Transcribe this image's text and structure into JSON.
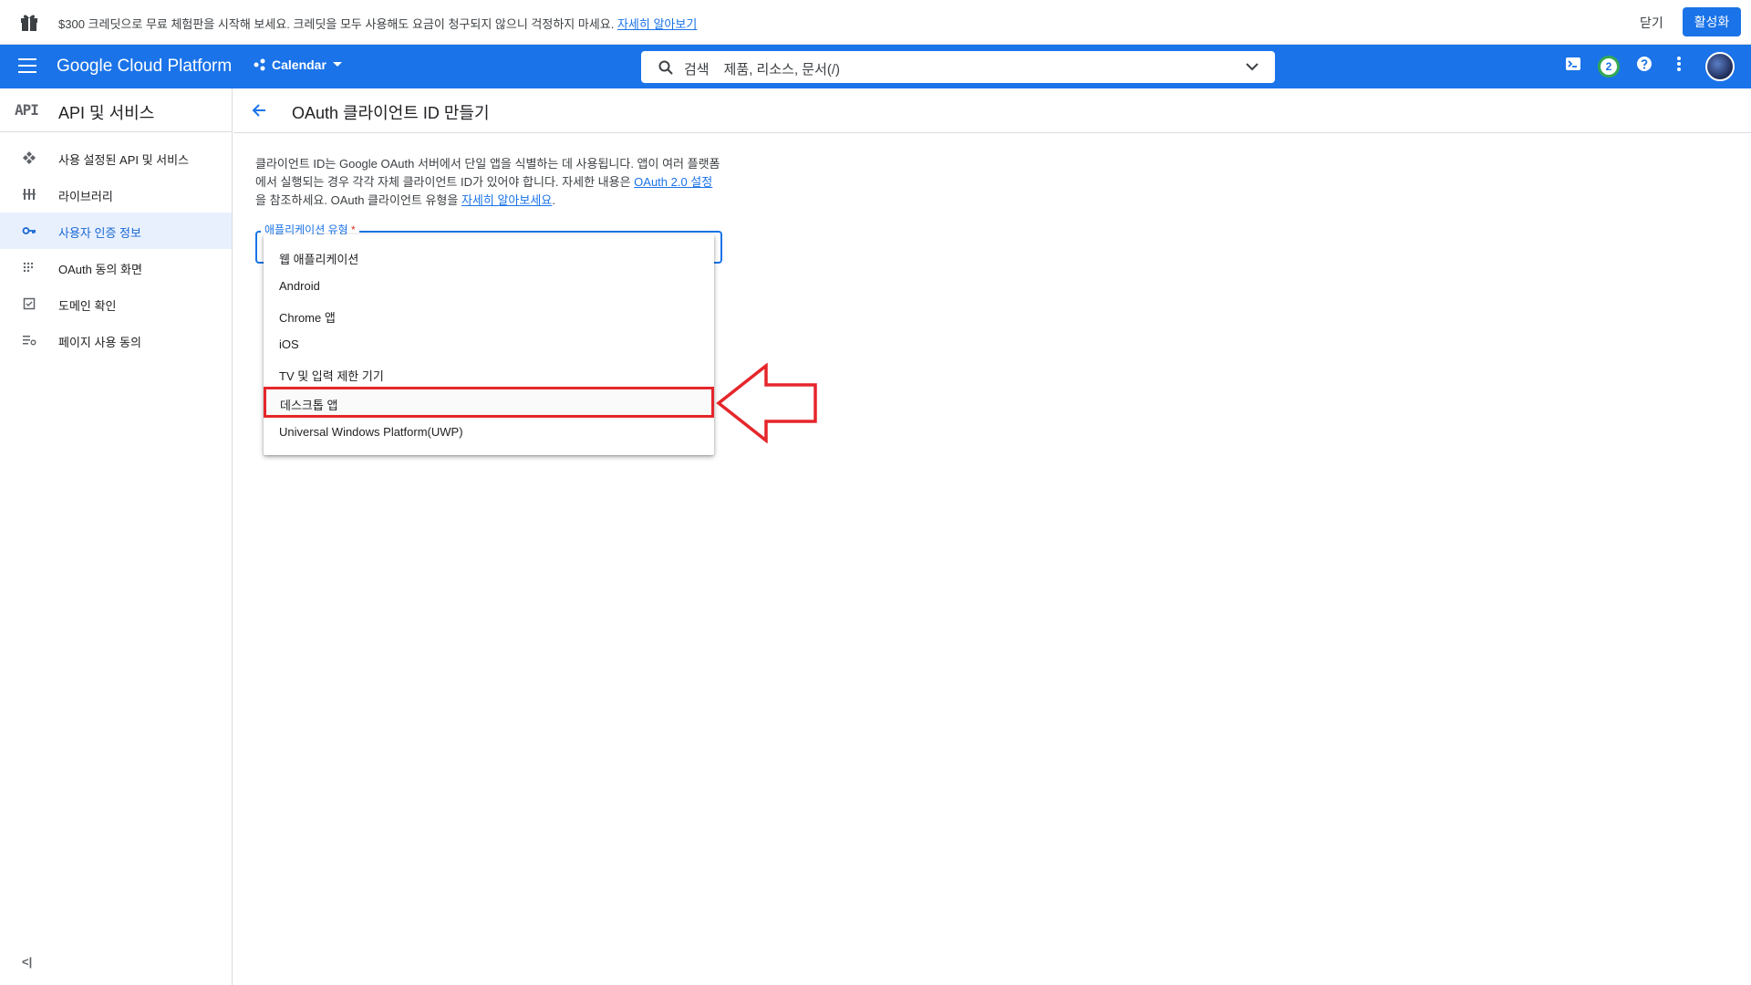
{
  "promo": {
    "message": "$300 크레딧으로 무료 체험판을 시작해 보세요. 크레딧을 모두 사용해도 요금이 청구되지 않으니 걱정하지 마세요.",
    "link": "자세히 알아보기",
    "close": "닫기",
    "activate": "활성화"
  },
  "topbar": {
    "brand": "Google Cloud Platform",
    "project": "Calendar",
    "search_prefix": "검색",
    "search_hint": "제품, 리소스, 문서(/)",
    "notification_count": "2"
  },
  "sidebar": {
    "badge": "API",
    "title": "API 및 서비스",
    "items": [
      {
        "label": "사용 설정된 API 및 서비스",
        "icon": "diamond-arrows-icon",
        "active": false
      },
      {
        "label": "라이브러리",
        "icon": "library-icon",
        "active": false
      },
      {
        "label": "사용자 인증 정보",
        "icon": "key-icon",
        "active": true
      },
      {
        "label": "OAuth 동의 화면",
        "icon": "dots-grid-icon",
        "active": false
      },
      {
        "label": "도메인 확인",
        "icon": "checkbox-icon",
        "active": false
      },
      {
        "label": "페이지 사용 동의",
        "icon": "settings-list-icon",
        "active": false
      }
    ],
    "collapse": "<|"
  },
  "main": {
    "title": "OAuth 클라이언트 ID 만들기",
    "description": {
      "part1": "클라이언트 ID는 Google OAuth 서버에서 단일 앱을 식별하는 데 사용됩니다. 앱이 여러 플랫폼에서 실행되는 경우 각각 자체 클라이언트 ID가 있어야 합니다. 자세한 내용은 ",
      "link1": "OAuth 2.0 설정",
      "part2": "을 참조하세요. OAuth 클라이언트 유형을 ",
      "link2": "자세히 알아보세요",
      "part3": "."
    },
    "field_label": "애플리케이션 유형",
    "field_required": "*",
    "options": [
      "웹 애플리케이션",
      "Android",
      "Chrome 앱",
      "iOS",
      "TV 및 입력 제한 기기",
      "데스크톱 앱",
      "Universal Windows Platform(UWP)"
    ],
    "highlighted_option": 5
  },
  "colors": {
    "primary": "#1a73e8",
    "highlight": "#e5262b"
  }
}
